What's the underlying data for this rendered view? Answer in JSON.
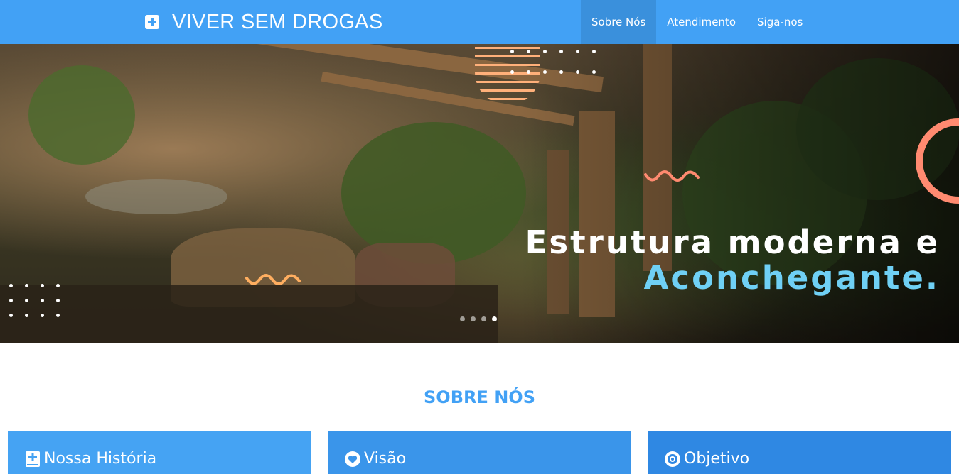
{
  "navbar": {
    "brand_icon": "medical-plus-icon",
    "brand_text": "VIVER SEM DROGAS",
    "items": [
      {
        "label": "Sobre Nós",
        "active": true
      },
      {
        "label": "Atendimento",
        "active": false
      },
      {
        "label": "Siga-nos",
        "active": false
      }
    ],
    "color": "#42a1f5"
  },
  "hero": {
    "title_line1": "Estrutura moderna e",
    "title_line2": "Aconchegante.",
    "accent_color": "#6fd0f5",
    "carousel": {
      "count": 4,
      "active_index": 3
    }
  },
  "section": {
    "title": "SOBRE NÓS",
    "cards": [
      {
        "icon": "medical-book-icon",
        "title": "Nossa História"
      },
      {
        "icon": "heart-circle-icon",
        "title": "Visão"
      },
      {
        "icon": "target-icon",
        "title": "Objetivo"
      }
    ]
  }
}
